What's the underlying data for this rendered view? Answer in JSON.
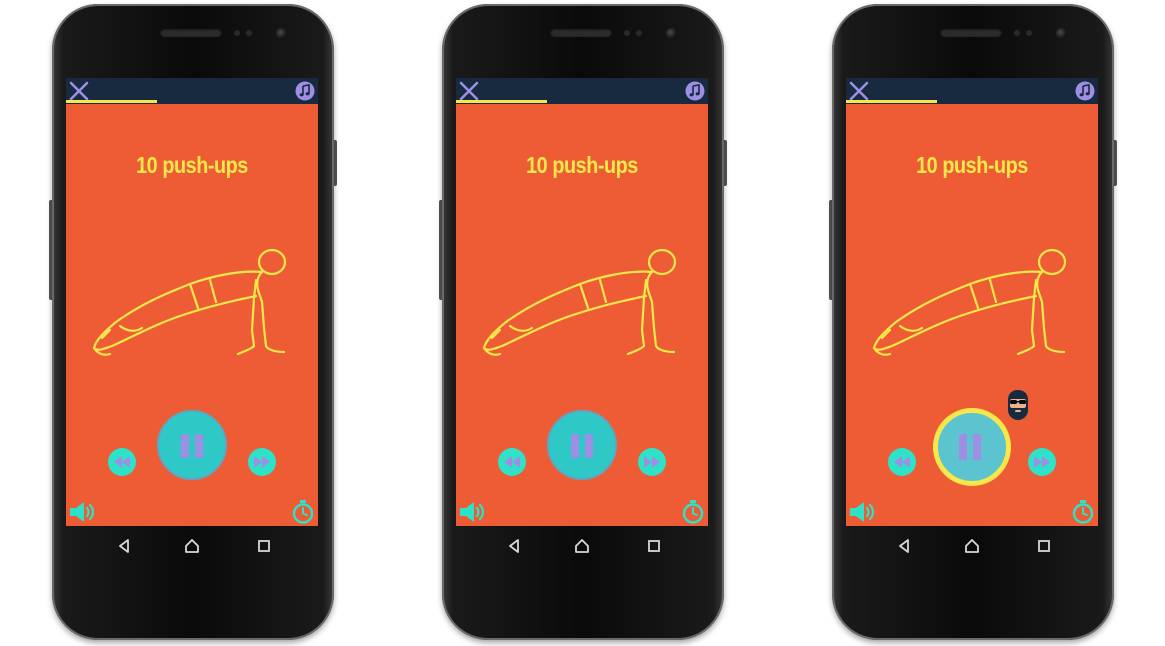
{
  "phones": [
    {
      "topbar": {
        "close_icon": "close-icon",
        "music_icon": "music-note-icon",
        "progress_fraction": 0.36
      },
      "exercise_title": "10 push-ups",
      "illustration": "push-up-figure",
      "controls": {
        "rewind_icon": "rewind-icon",
        "pause_icon": "pause-icon",
        "forward_icon": "fast-forward-icon",
        "pause_highlighted": false
      },
      "bottom": {
        "volume_icon": "volume-icon",
        "timer_icon": "stopwatch-icon"
      },
      "avatar_shown": false
    },
    {
      "topbar": {
        "close_icon": "close-icon",
        "music_icon": "music-note-icon",
        "progress_fraction": 0.36
      },
      "exercise_title": "10 push-ups",
      "illustration": "push-up-figure",
      "controls": {
        "rewind_icon": "rewind-icon",
        "pause_icon": "pause-icon",
        "forward_icon": "fast-forward-icon",
        "pause_highlighted": false
      },
      "bottom": {
        "volume_icon": "volume-icon",
        "timer_icon": "stopwatch-icon"
      },
      "avatar_shown": false
    },
    {
      "topbar": {
        "close_icon": "close-icon",
        "music_icon": "music-note-icon",
        "progress_fraction": 0.36
      },
      "exercise_title": "10 push-ups",
      "illustration": "push-up-figure",
      "controls": {
        "rewind_icon": "rewind-icon",
        "pause_icon": "pause-icon",
        "forward_icon": "fast-forward-icon",
        "pause_highlighted": true
      },
      "bottom": {
        "volume_icon": "volume-icon",
        "timer_icon": "stopwatch-icon"
      },
      "avatar_shown": true
    }
  ],
  "colors": {
    "screen_bg": "#ee5c35",
    "topbar_bg": "#172a40",
    "accent_yellow": "#f6e84a",
    "accent_purple": "#9e8ee4",
    "accent_teal": "#2ec9c7"
  }
}
